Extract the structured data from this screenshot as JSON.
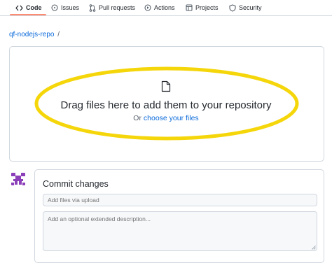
{
  "nav": {
    "tabs": [
      {
        "label": "Code",
        "icon": "code-icon",
        "active": true
      },
      {
        "label": "Issues",
        "icon": "issue-circle-icon",
        "active": false
      },
      {
        "label": "Pull requests",
        "icon": "pull-request-icon",
        "active": false
      },
      {
        "label": "Actions",
        "icon": "play-circle-icon",
        "active": false
      },
      {
        "label": "Projects",
        "icon": "table-icon",
        "active": false
      },
      {
        "label": "Security",
        "icon": "shield-icon",
        "active": false
      }
    ],
    "active_underline_color": "#fd8c73"
  },
  "breadcrumb": {
    "repo": "qf-nodejs-repo",
    "separator": "/"
  },
  "upload": {
    "title": "Drag files here to add them to your repository",
    "prefix": "Or",
    "link": "choose your files",
    "highlight_color": "#f5d60a"
  },
  "commit": {
    "title": "Commit changes",
    "summary_placeholder": "Add files via upload",
    "description_placeholder": "Add an optional extended description..."
  },
  "colors": {
    "link": "#0969da",
    "border": "#d0d7de",
    "avatar": "#8b3fb8"
  }
}
